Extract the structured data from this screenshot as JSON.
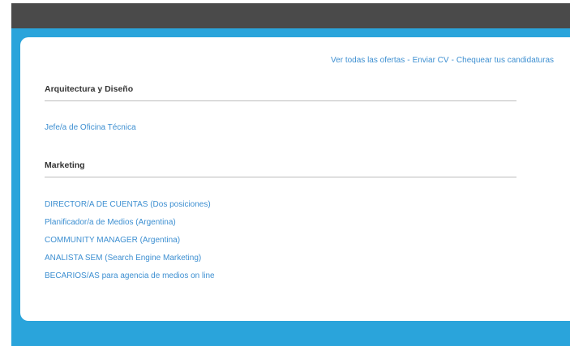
{
  "top_links": {
    "all_offers": "Ver todas las ofertas",
    "send_cv": "Enviar CV",
    "check_applications": "Chequear tus candidaturas",
    "separator": "-"
  },
  "sections": [
    {
      "title": "Arquitectura y Diseño",
      "jobs": [
        "Jefe/a de Oficina Técnica"
      ]
    },
    {
      "title": "Marketing",
      "jobs": [
        "DIRECTOR/A DE CUENTAS (Dos posiciones)",
        "Planificador/a de Medios (Argentina)",
        "COMMUNITY MANAGER (Argentina)",
        "ANALISTA SEM (Search Engine Marketing)",
        "BECARIOS/AS para agencia de medios on line"
      ]
    }
  ],
  "colors": {
    "header_bar": "#4a4a4a",
    "accent_blue": "#2aa4db",
    "link_blue": "#3d8fd1"
  }
}
